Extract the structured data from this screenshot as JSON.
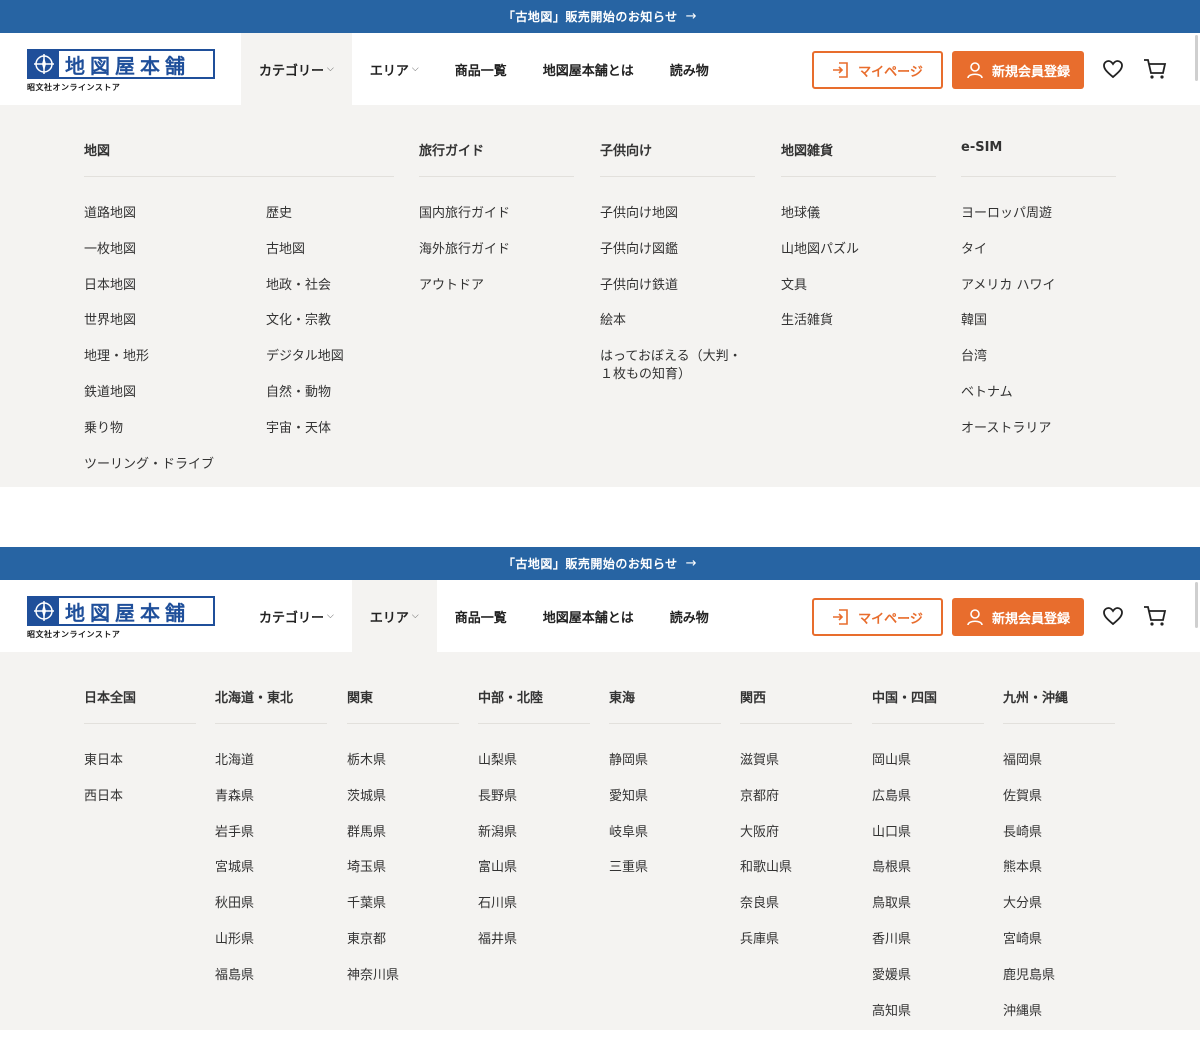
{
  "announcement": {
    "text": "「古地図」販売開始のお知らせ",
    "arrow": "→"
  },
  "logo": {
    "title": "地図屋本舗",
    "subtitle": "昭文社オンラインストア"
  },
  "nav": {
    "items": [
      {
        "label": "カテゴリー",
        "chevron": "⌵"
      },
      {
        "label": "エリア",
        "chevron": "⌵"
      },
      {
        "label": "商品一覧"
      },
      {
        "label": "地図屋本舗とは"
      },
      {
        "label": "読み物"
      }
    ]
  },
  "buttons": {
    "mypage": "マイページ",
    "register": "新規会員登録"
  },
  "colors": {
    "brand_blue": "#2764a3",
    "accent_orange": "#e86d2d",
    "menu_bg": "#f4f3f1"
  },
  "category_menu": {
    "map": {
      "heading": "地図",
      "col_a": [
        "道路地図",
        "一枚地図",
        "日本地図",
        "世界地図",
        "地理・地形",
        "鉄道地図",
        "乗り物",
        "ツーリング・ドライブ"
      ],
      "col_b": [
        "歴史",
        "古地図",
        "地政・社会",
        "文化・宗教",
        "デジタル地図",
        "自然・動物",
        "宇宙・天体"
      ]
    },
    "travel": {
      "heading": "旅行ガイド",
      "items": [
        "国内旅行ガイド",
        "海外旅行ガイド",
        "アウトドア"
      ]
    },
    "kids": {
      "heading": "子供向け",
      "items": [
        "子供向け地図",
        "子供向け図鑑",
        "子供向け鉄道",
        "絵本",
        "はっておぼえる（大判・１枚もの知育）"
      ]
    },
    "goods": {
      "heading": "地図雑貨",
      "items": [
        "地球儀",
        "山地図パズル",
        "文具",
        "生活雑貨"
      ]
    },
    "esim": {
      "heading": "e-SIM",
      "items": [
        "ヨーロッパ周遊",
        "タイ",
        "アメリカ ハワイ",
        "韓国",
        "台湾",
        "ベトナム",
        "オーストラリア"
      ]
    }
  },
  "area_menu": {
    "japan": {
      "heading": "日本全国",
      "items": [
        "東日本",
        "西日本"
      ]
    },
    "hokkaido_tohoku": {
      "heading": "北海道・東北",
      "items": [
        "北海道",
        "青森県",
        "岩手県",
        "宮城県",
        "秋田県",
        "山形県",
        "福島県"
      ]
    },
    "kanto": {
      "heading": "関東",
      "items": [
        "栃木県",
        "茨城県",
        "群馬県",
        "埼玉県",
        "千葉県",
        "東京都",
        "神奈川県"
      ]
    },
    "chubu_hokuriku": {
      "heading": "中部・北陸",
      "items": [
        "山梨県",
        "長野県",
        "新潟県",
        "富山県",
        "石川県",
        "福井県"
      ]
    },
    "tokai": {
      "heading": "東海",
      "items": [
        "静岡県",
        "愛知県",
        "岐阜県",
        "三重県"
      ]
    },
    "kansai": {
      "heading": "関西",
      "items": [
        "滋賀県",
        "京都府",
        "大阪府",
        "和歌山県",
        "奈良県",
        "兵庫県"
      ]
    },
    "chugoku_shikoku": {
      "heading": "中国・四国",
      "items": [
        "岡山県",
        "広島県",
        "山口県",
        "島根県",
        "鳥取県",
        "香川県",
        "愛媛県",
        "高知県"
      ]
    },
    "kyushu_okinawa": {
      "heading": "九州・沖縄",
      "items": [
        "福岡県",
        "佐賀県",
        "長崎県",
        "熊本県",
        "大分県",
        "宮崎県",
        "鹿児島県",
        "沖縄県"
      ]
    }
  }
}
